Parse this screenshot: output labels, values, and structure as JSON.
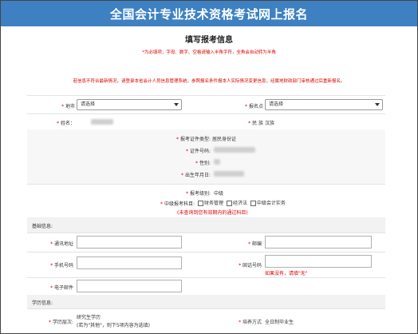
{
  "header": {
    "title": "全国会计专业技术资格考试网上报名"
  },
  "page": {
    "title": "填写报考信息",
    "note_format": "*为必填项，字母、数字、空格请输入半角字符，全角会自动转为半角",
    "note_info": "若信息不符合最新情况，请登录本省会计人员信息管理系统，参照报名条件报本人实际情况变更信息，经属地财政部门审核通过后重新报名。"
  },
  "fields": {
    "region_label": "地市",
    "region_value": "请选择",
    "site_label": "报名点",
    "site_value": "请选择",
    "name_label": "姓名：",
    "ethnic_label": "民 族",
    "ethnic_value": "汉族",
    "id_type_label": "报考证件类型:",
    "id_type_value": "居民身份证",
    "id_no_label": "证件号码:",
    "gender_label": "性别:",
    "birth_label": "出生年月日:",
    "level_label": "报考级别:",
    "level_value": "中级",
    "subjects_label": "中级报考科目:",
    "subjects": [
      "财务管理",
      "经济法",
      "中级会计实务"
    ],
    "subjects_hint": "(未查询到您有效期内的通过科目)"
  },
  "basic": {
    "section_label": "基础信息:",
    "address_label": "通讯地址",
    "postcode_label": "邮编",
    "mobile_label": "手机号码",
    "phone_label": "固话号码",
    "phone_hint": "如果没有，请填\"无\"",
    "email_label": "电子邮件"
  },
  "education": {
    "section_label": "学历信息:",
    "level_label": "学历层次:",
    "level_value": "研究生学历",
    "level_hint": "(若为\"其他\"，则下5项内容为选填)",
    "mode_label": "培养方式",
    "mode_value": "全日制毕业生"
  },
  "colors": {
    "header": "#3d81c2",
    "required": "#e00000"
  }
}
